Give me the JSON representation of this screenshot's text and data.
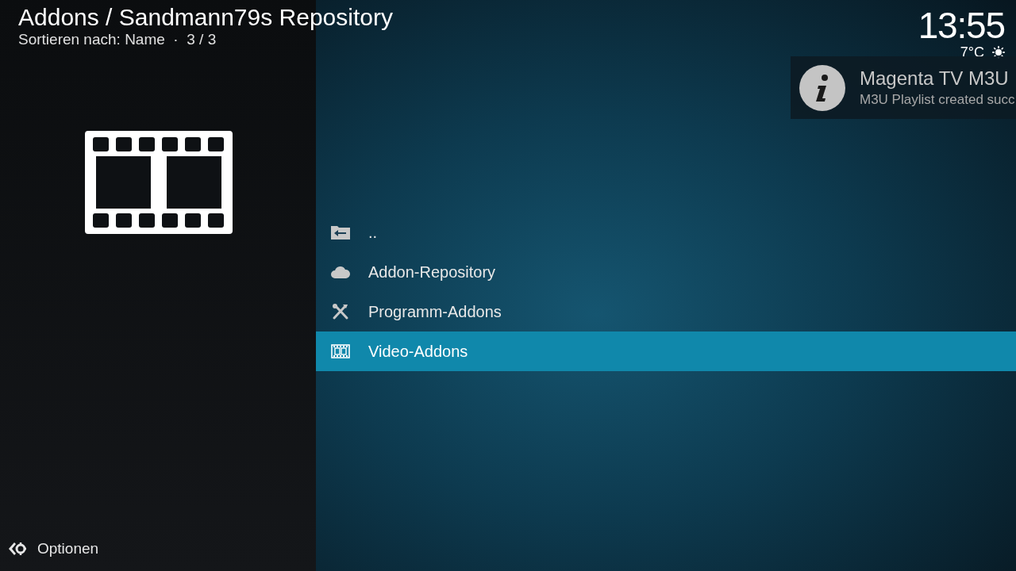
{
  "header": {
    "title": "Addons / Sandmann79s Repository",
    "subtitle": "Sortieren nach: Name  ·  3 / 3"
  },
  "clock": {
    "time": "13:55",
    "temperature": "7°C"
  },
  "notification": {
    "title": "Magenta TV M3U",
    "message": "M3U Playlist created succ"
  },
  "list": [
    {
      "kind": "parent",
      "label": "..",
      "selected": false
    },
    {
      "kind": "cloud",
      "label": "Addon-Repository",
      "selected": false
    },
    {
      "kind": "tools",
      "label": "Programm-Addons",
      "selected": false
    },
    {
      "kind": "film",
      "label": "Video-Addons",
      "selected": true
    }
  ],
  "footer": {
    "label": "Optionen"
  }
}
